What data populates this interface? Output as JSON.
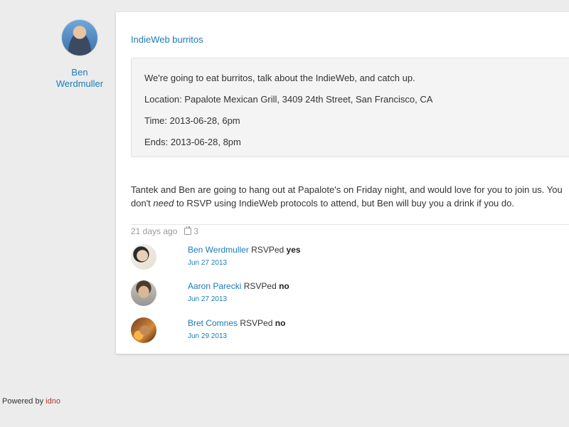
{
  "author": {
    "name": "Ben Werdmuller"
  },
  "post": {
    "title": "IndieWeb burritos",
    "event": {
      "description": "We're going to eat burritos, talk about the IndieWeb, and catch up.",
      "location": "Location: Papalote Mexican Grill, 3409 24th Street, San Francisco, CA",
      "time": "Time: 2013-06-28, 6pm",
      "ends": "Ends: 2013-06-28, 8pm"
    },
    "body_part1": "Tantek and Ben are going to hang out at Papalote's on Friday night, and would love for you to join us. You don't ",
    "body_em": "need",
    "body_part2": " to RSVP using IndieWeb protocols to attend, but Ben will buy you a drink if you do.",
    "age": "21 days ago",
    "rsvp_count": "3",
    "rsvp_icon": "calendar-icon"
  },
  "rsvps": [
    {
      "name": "Ben Werdmuller",
      "verb": "RSVPed",
      "answer": "yes",
      "date": "Jun 27 2013"
    },
    {
      "name": "Aaron Parecki",
      "verb": "RSVPed",
      "answer": "no",
      "date": "Jun 27 2013"
    },
    {
      "name": "Bret Comnes",
      "verb": "RSVPed",
      "answer": "no",
      "date": "Jun 29 2013"
    }
  ],
  "footer": {
    "prefix": "Powered by ",
    "link": "idno"
  },
  "colors": {
    "link": "#1a7bb9",
    "footer_link": "#b03a2e",
    "background": "#ececec"
  }
}
